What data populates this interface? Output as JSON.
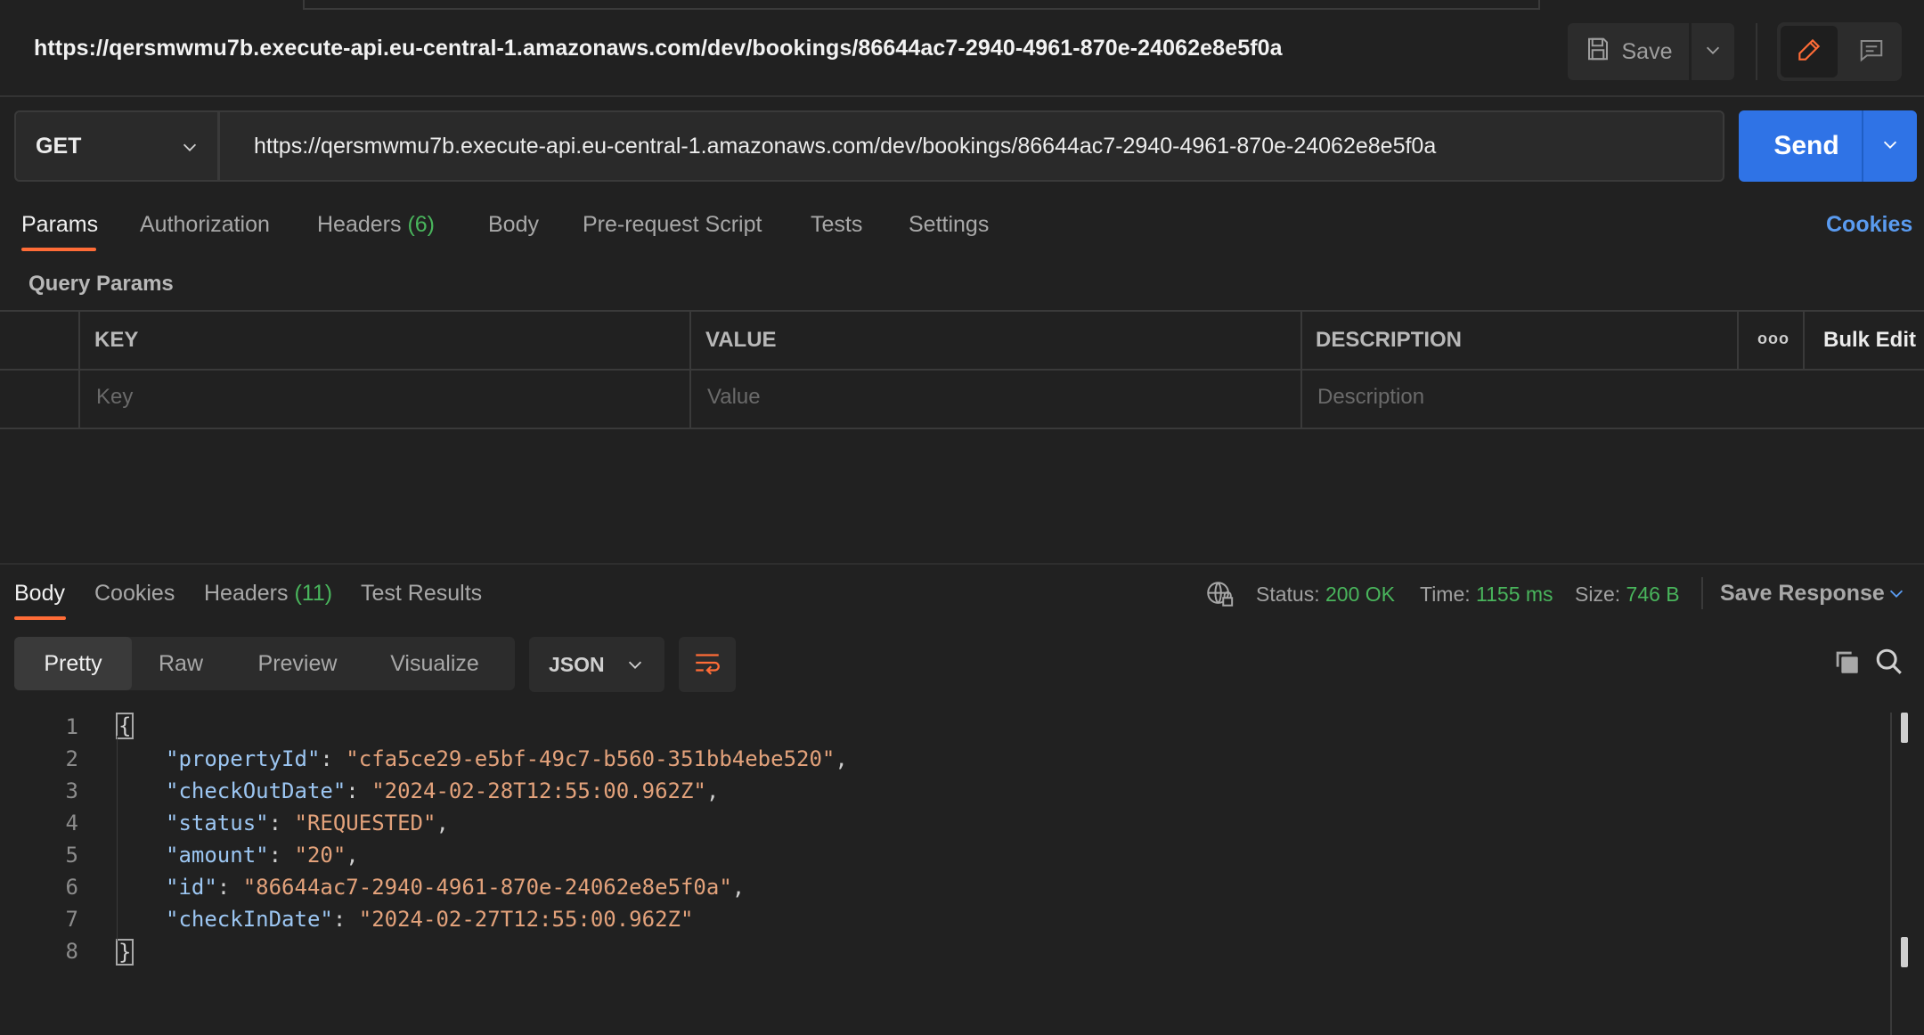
{
  "header": {
    "title": "https://qersmwmu7b.execute-api.eu-central-1.amazonaws.com/dev/bookings/86644ac7-2940-4961-870e-24062e8e5f0a",
    "save_label": "Save",
    "icons": [
      "save-icon",
      "chevron-down-icon",
      "pencil-icon",
      "comment-icon"
    ]
  },
  "request": {
    "method": "GET",
    "url": "https://qersmwmu7b.execute-api.eu-central-1.amazonaws.com/dev/bookings/86644ac7-2940-4961-870e-24062e8e5f0a",
    "send_label": "Send"
  },
  "request_tabs": {
    "params": "Params",
    "authorization": "Authorization",
    "headers": "Headers",
    "headers_count": "(6)",
    "body": "Body",
    "prerequest": "Pre-request Script",
    "tests": "Tests",
    "settings": "Settings",
    "cookies": "Cookies"
  },
  "query_params": {
    "label": "Query Params",
    "columns": {
      "key": "KEY",
      "value": "VALUE",
      "description": "DESCRIPTION"
    },
    "more": "ooo",
    "bulk_edit": "Bulk Edit",
    "placeholders": {
      "key": "Key",
      "value": "Value",
      "description": "Description"
    }
  },
  "response_tabs": {
    "body": "Body",
    "cookies": "Cookies",
    "headers": "Headers",
    "headers_count": "(11)",
    "test_results": "Test Results"
  },
  "response_status": {
    "status_label": "Status:",
    "status_value": "200 OK",
    "time_label": "Time:",
    "time_value": "1155 ms",
    "size_label": "Size:",
    "size_value": "746 B",
    "save_response": "Save Response"
  },
  "view_modes": [
    "Pretty",
    "Raw",
    "Preview",
    "Visualize"
  ],
  "active_view": "Pretty",
  "format": "JSON",
  "colors": {
    "accent_orange": "#ff6c37",
    "send_blue": "#2f73e6",
    "success_green": "#49b55c",
    "json_key": "#9cc6f2",
    "json_string": "#e3a27b"
  },
  "code": {
    "line_numbers": [
      "1",
      "2",
      "3",
      "4",
      "5",
      "6",
      "7",
      "8"
    ],
    "open_brace": "{",
    "close_brace": "}",
    "entries": [
      {
        "key": "\"propertyId\"",
        "value": "\"cfa5ce29-e5bf-49c7-b560-351bb4ebe520\"",
        "comma": ","
      },
      {
        "key": "\"checkOutDate\"",
        "value": "\"2024-02-28T12:55:00.962Z\"",
        "comma": ","
      },
      {
        "key": "\"status\"",
        "value": "\"REQUESTED\"",
        "comma": ","
      },
      {
        "key": "\"amount\"",
        "value": "\"20\"",
        "comma": ","
      },
      {
        "key": "\"id\"",
        "value": "\"86644ac7-2940-4961-870e-24062e8e5f0a\"",
        "comma": ","
      },
      {
        "key": "\"checkInDate\"",
        "value": "\"2024-02-27T12:55:00.962Z\"",
        "comma": ""
      }
    ],
    "separator": ": "
  }
}
